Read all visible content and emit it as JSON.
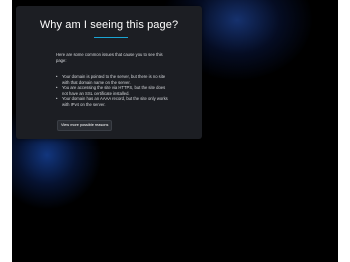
{
  "heading": "Why am I seeing this page?",
  "intro": "Here are some common issues that cause you to see this page:",
  "reasons": [
    "Your domain is pointed to the server, but there is no site with that domain name on the server.",
    "You are accessing the site via HTTPS, but the site does not have an SSL certificate installed.",
    "Your domain has an AAAA record, but the site only works with IPv4 on the server."
  ],
  "button_label": "View more possible reasons",
  "colors": {
    "accent": "#1aa5d4",
    "card": "#1c1e23",
    "background": "#000000"
  }
}
